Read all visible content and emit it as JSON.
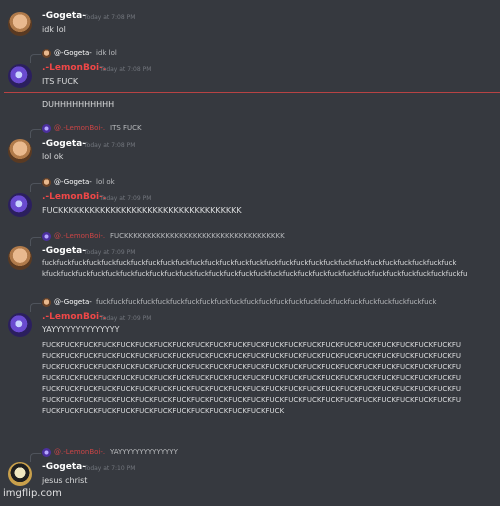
{
  "messages": [
    {
      "author": "-Gogeta-",
      "timestamp": "Today at 7:08 PM",
      "text": "idk lol"
    },
    {
      "reply_to_author": "@-Gogeta-",
      "reply_text": "idk lol",
      "author": ".-LemonBoi-.",
      "timestamp": "Today at 7:08 PM",
      "text": "ITS FUCK"
    },
    {
      "text": "DUHHHHHHHHHH"
    },
    {
      "reply_to_author": "@.-LemonBoi-.",
      "reply_text": "ITS FUCK",
      "author": "-Gogeta-",
      "timestamp": "Today at 7:08 PM",
      "text": "lol ok"
    },
    {
      "reply_to_author": "@-Gogeta-",
      "reply_text": "lol ok",
      "author": ".-LemonBoi-.",
      "timestamp": "Today at 7:09 PM",
      "text": "FUCKKKKKKKKKKKKKKKKKKKKKKKKKKKKKKKKKKK"
    },
    {
      "reply_to_author": "@.-LemonBoi-.",
      "reply_text": "FUCKKKKKKKKKKKKKKKKKKKKKKKKKKKKKKKKKKK",
      "author": "-Gogeta-",
      "timestamp": "Today at 7:09 PM",
      "lines": [
        "fuckfuckfuckfuckfuckfuckfuckfuckfuckfuckfuckfuckfuckfuckfuckfuckfuckfuckfuckfuckfuckfuckfuckfuckfuckfuckfuckfuck",
        "kfuckfuckfuckfuckfuckfuckfuckfuckfuckfuckfuckfuckfuckfuckfuckfuckfuckfuckfuckfuckfuckfuckfuckfuckfuckfuckfuckfuckfu"
      ]
    },
    {
      "reply_to_author": "@-Gogeta-",
      "reply_text": "fuckfuckfuckfuckfuckfuckfuckfuckfuckfuckfuckfuckfuckfuckfuckfuckfuckfuckfuckfuckfuckfuckfuck",
      "author": ".-LemonBoi-.",
      "timestamp": "Today at 7:09 PM",
      "text": "YAYYYYYYYYYYYYYY",
      "lines": [
        "FUCKFUCKFUCKFUCKFUCKFUCKFUCKFUCKFUCKFUCKFUCKFUCKFUCKFUCKFUCKFUCKFUCKFUCKFUCKFUCKFUCKFUCKFU",
        "FUCKFUCKFUCKFUCKFUCKFUCKFUCKFUCKFUCKFUCKFUCKFUCKFUCKFUCKFUCKFUCKFUCKFUCKFUCKFUCKFUCKFUCKFU",
        "FUCKFUCKFUCKFUCKFUCKFUCKFUCKFUCKFUCKFUCKFUCKFUCKFUCKFUCKFUCKFUCKFUCKFUCKFUCKFUCKFUCKFUCKFU",
        "FUCKFUCKFUCKFUCKFUCKFUCKFUCKFUCKFUCKFUCKFUCKFUCKFUCKFUCKFUCKFUCKFUCKFUCKFUCKFUCKFUCKFUCKFU",
        "FUCKFUCKFUCKFUCKFUCKFUCKFUCKFUCKFUCKFUCKFUCKFUCKFUCKFUCKFUCKFUCKFUCKFUCKFUCKFUCKFUCKFUCKFU",
        "FUCKFUCKFUCKFUCKFUCKFUCKFUCKFUCKFUCKFUCKFUCKFUCKFUCKFUCKFUCKFUCKFUCKFUCKFUCKFUCKFUCKFUCKFU",
        "FUCKFUCKFUCKFUCKFUCKFUCKFUCKFUCKFUCKFUCKFUCKFUCKFUCK"
      ]
    },
    {
      "reply_to_author": "@.-LemonBoi-.",
      "reply_text": "YAYYYYYYYYYYYYYY",
      "author": "-Gogeta-",
      "timestamp": "Today at 7:10 PM",
      "text": "jesus christ"
    }
  ],
  "watermark": "imgflip.com",
  "colors": {
    "background": "#36393f",
    "lemon_name": "#f04747",
    "timestamp": "#72767d",
    "text": "#dcddde"
  }
}
